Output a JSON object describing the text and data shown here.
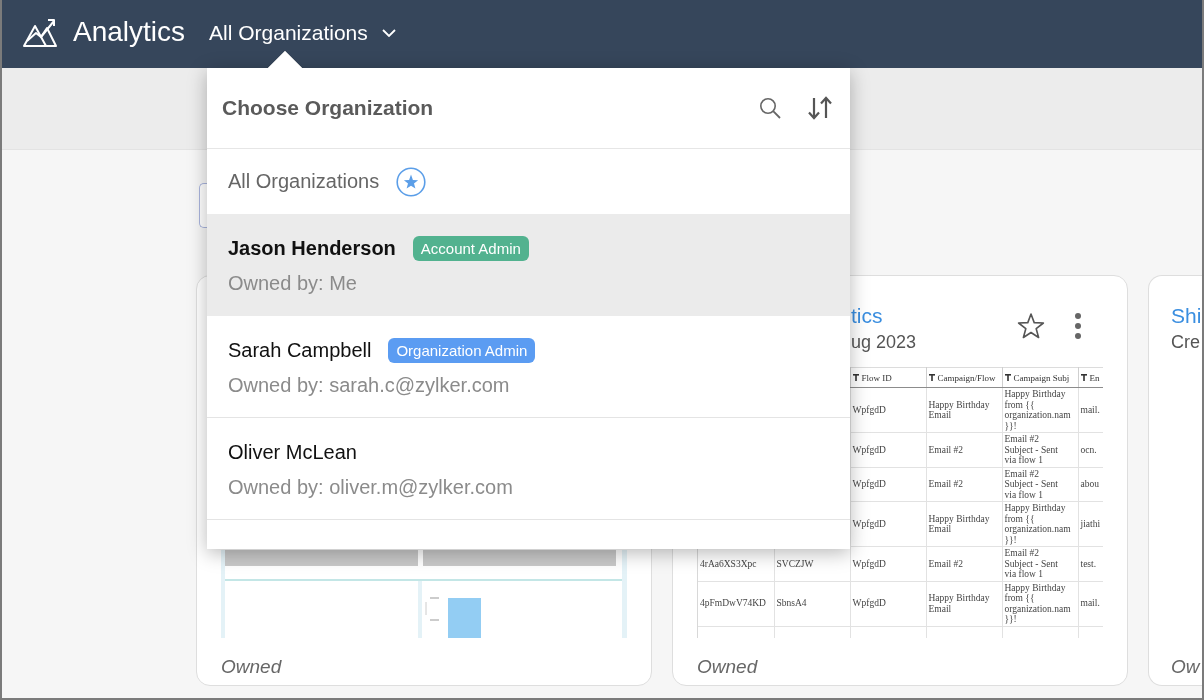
{
  "top_bar": {
    "title": "Analytics",
    "org_switcher": {
      "label": "All Organizations",
      "expanded": true
    }
  },
  "org_menu": {
    "title": "Choose Organization",
    "all_option": {
      "label": "All Organizations",
      "starred": true,
      "selected": false
    },
    "organizations": [
      {
        "name": "Jason Henderson",
        "badge": {
          "label": "Account Admin",
          "color": "#52b28f"
        },
        "owner": "Owned by: Me",
        "selected": true
      },
      {
        "name": "Sarah Campbell",
        "badge": {
          "label": "Organization Admin",
          "color": "#5b9cf2"
        },
        "owner": "Owned by: sarah.c@zylker.com",
        "selected": false
      },
      {
        "name": "Oliver McLean",
        "owner": "Owned by: oliver.m@zylker.com",
        "selected": false
      }
    ]
  },
  "cards": [
    {
      "kind": "dashboard",
      "footer": "Owned"
    },
    {
      "kind": "table",
      "title": "tics",
      "subtitle": "ug 2023",
      "starred": false,
      "menu_button": true,
      "table": {
        "columns": [
          null,
          null,
          {
            "label": "Flow ID"
          },
          {
            "label": "Campaign/Flow"
          },
          {
            "label": "Campaign Subj"
          },
          {
            "label": "En"
          }
        ],
        "rows": [
          [
            null,
            null,
            "WpfgdD",
            "Happy Birthday Email",
            "Happy Birthday\nfrom {{\norganization.nam\n}}!",
            "mail."
          ],
          [
            null,
            null,
            "WpfgdD",
            "Email #2",
            "Email #2\nSubject - Sent\nvia flow 1",
            "ocn."
          ],
          [
            null,
            null,
            "WpfgdD",
            "Email #2",
            "Email #2\nSubject - Sent\nvia flow 1",
            "abou"
          ],
          [
            null,
            null,
            "WpfgdD",
            "Happy Birthday Email",
            "Happy Birthday\nfrom {{\norganization.nam\n}}!",
            "jiathi"
          ],
          [
            "4rAa6XS3Xpc",
            "SVCZJW",
            "WpfgdD",
            "Email #2",
            "Email #2\nSubject - Sent\nvia flow 1",
            "test."
          ],
          [
            "4pFmDwV74KD",
            "SbnsA4",
            "WpfgdD",
            "Happy Birthday Email",
            "Happy Birthday\nfrom {{\norganization.nam\n}}!",
            "mail."
          ]
        ]
      },
      "footer": "Owned"
    },
    {
      "kind": "blank",
      "title": "Shi",
      "subtitle": "Cre",
      "footer": "Ow"
    }
  ]
}
